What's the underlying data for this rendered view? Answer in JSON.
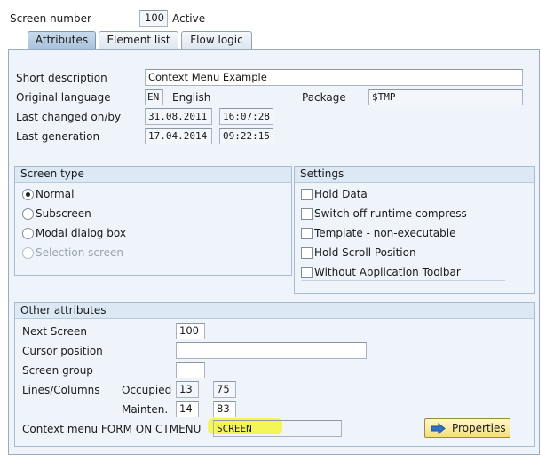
{
  "header": {
    "screen_number_label": "Screen number",
    "screen_number": "100",
    "status": "Active"
  },
  "tabs": [
    {
      "label": "Attributes",
      "active": true
    },
    {
      "label": "Element list",
      "active": false
    },
    {
      "label": "Flow logic",
      "active": false
    }
  ],
  "attributes": {
    "short_description_label": "Short description",
    "short_description": "Context Menu Example",
    "original_language_label": "Original language",
    "language_code": "EN",
    "language_name": "English",
    "package_label": "Package",
    "package": "$TMP",
    "last_changed_label": "Last changed on/by",
    "last_changed_date": "31.08.2011",
    "last_changed_time": "16:07:28",
    "last_generation_label": "Last generation",
    "last_generation_date": "17.04.2014",
    "last_generation_time": "09:22:15"
  },
  "screen_type": {
    "title": "Screen type",
    "options": [
      {
        "label": "Normal",
        "selected": true,
        "enabled": true
      },
      {
        "label": "Subscreen",
        "selected": false,
        "enabled": true
      },
      {
        "label": "Modal dialog box",
        "selected": false,
        "enabled": true
      },
      {
        "label": "Selection screen",
        "selected": false,
        "enabled": false
      }
    ]
  },
  "settings": {
    "title": "Settings",
    "options": [
      {
        "label": "Hold Data",
        "checked": false
      },
      {
        "label": "Switch off runtime compress",
        "checked": false
      },
      {
        "label": "Template - non-executable",
        "checked": false
      },
      {
        "label": "Hold Scroll Position",
        "checked": false
      },
      {
        "label": "Without Application Toolbar",
        "checked": false
      }
    ]
  },
  "other": {
    "title": "Other attributes",
    "next_screen_label": "Next Screen",
    "next_screen": "100",
    "cursor_position_label": "Cursor position",
    "cursor_position": "",
    "screen_group_label": "Screen group",
    "screen_group": "",
    "lines_columns_label": "Lines/Columns",
    "occupied_label": "Occupied",
    "occupied_lines": "13",
    "occupied_columns": "75",
    "mainten_label": "Mainten.",
    "mainten_lines": "14",
    "mainten_columns": "83",
    "context_menu_label": "Context menu FORM ON CTMENU",
    "context_menu_value": "SCREEN",
    "properties_button": "Properties"
  },
  "colors": {
    "highlight": "#f5f53a",
    "panel_bg": "#eef4fa",
    "button_bg": "#f3df7a",
    "arrow_icon": "#2f73c9"
  }
}
